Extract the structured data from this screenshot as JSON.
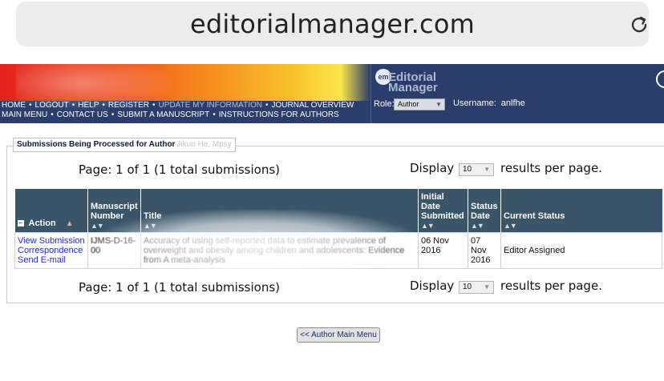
{
  "browser": {
    "url": "editorialmanager.com",
    "reload_icon": "reload-icon"
  },
  "header": {
    "nav_row1": [
      {
        "label": "HOME"
      },
      {
        "label": "LOGOUT"
      },
      {
        "label": "HELP"
      },
      {
        "label": "REGISTER"
      },
      {
        "label": "UPDATE MY INFORMATION"
      },
      {
        "label": "JOURNAL OVERVIEW"
      }
    ],
    "nav_row2": [
      {
        "label": "MAIN MENU"
      },
      {
        "label": "CONTACT US"
      },
      {
        "label": "SUBMIT A MANUSCRIPT"
      },
      {
        "label": "INSTRUCTIONS FOR AUTHORS"
      }
    ],
    "logo_badge": "em",
    "logo_line1": "Editorial",
    "logo_line2": "Manager",
    "role_label": "Role:",
    "role_value": "Author",
    "username_label": "Username:",
    "username_value": "anlfhe",
    "colors": {
      "bar": "#2a3d6b",
      "banner_start": "#e4221b",
      "banner_end": "#f9e64c"
    }
  },
  "panel": {
    "legend": "Submissions Being Processed for Author",
    "legend_name": "Jikuo He, Mpsy"
  },
  "pagination": {
    "page_text": "Page: 1 of 1 (1 total submissions)",
    "display_label": "Display",
    "per_page": "10",
    "display_suffix": "results per page."
  },
  "table": {
    "headers": {
      "action": "Action",
      "manuscript_number": "Manuscript Number",
      "title": "Title",
      "initial_date": "Initial Date Submitted",
      "status_date": "Status Date",
      "current_status": "Current Status"
    },
    "header_color": "#3a5568",
    "rows": [
      {
        "actions": [
          "View Submission",
          "Correspondence",
          "Send E-mail"
        ],
        "manuscript_number": "IJMS-D-16-00",
        "title": "Accuracy of using self-reported data to estimate prevalence of overweight and obesity among children and adolescents: Evidence from A meta-analysis",
        "initial_date": "06 Nov 2016",
        "status_date": "07 Nov 2016",
        "current_status": "Editor Assigned"
      }
    ]
  },
  "footer": {
    "main_menu_button": "<< Author Main Menu"
  }
}
